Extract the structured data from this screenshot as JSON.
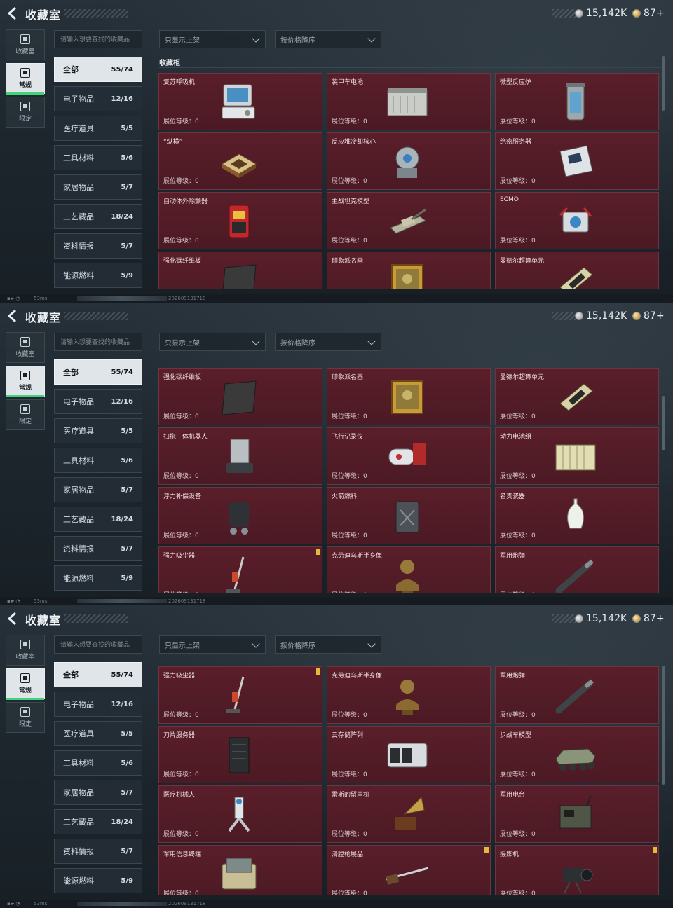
{
  "header": {
    "title": "收藏室",
    "silver_balance": "15,142K",
    "gold_balance": "87+"
  },
  "side_nav": [
    {
      "label": "收藏室",
      "icon": "collection-room-icon"
    },
    {
      "label": "常规",
      "icon": "regular-icon",
      "active": true
    },
    {
      "label": "限定",
      "icon": "limited-icon"
    }
  ],
  "search": {
    "placeholder": "请输入想要查找的收藏品"
  },
  "filter": {
    "value": "只显示上架"
  },
  "sort": {
    "value": "按价格降序"
  },
  "categories": [
    {
      "label": "全部",
      "count": "55/74",
      "active": true
    },
    {
      "label": "电子物品",
      "count": "12/16"
    },
    {
      "label": "医疗道具",
      "count": "5/5"
    },
    {
      "label": "工具材料",
      "count": "5/6"
    },
    {
      "label": "家居物品",
      "count": "5/7"
    },
    {
      "label": "工艺藏品",
      "count": "18/24"
    },
    {
      "label": "资料情报",
      "count": "5/7"
    },
    {
      "label": "能源燃料",
      "count": "5/9"
    }
  ],
  "section_title": "收藏柜",
  "level_label": "展位等级：0",
  "items": [
    {
      "name": "复苏呼吸机",
      "icon": "ventilator-icon"
    },
    {
      "name": "装甲车电池",
      "icon": "vehicle-battery-icon"
    },
    {
      "name": "微型反应炉",
      "icon": "micro-reactor-icon"
    },
    {
      "name": "“纵横”",
      "icon": "chessboard-icon"
    },
    {
      "name": "反应堆冷却核心",
      "icon": "reactor-core-icon"
    },
    {
      "name": "绝密服务器",
      "icon": "server-board-icon"
    },
    {
      "name": "自动体外除颤器",
      "icon": "defibrillator-icon"
    },
    {
      "name": "主战坦克模型",
      "icon": "tank-model-icon"
    },
    {
      "name": "ECMO",
      "icon": "ecmo-icon"
    },
    {
      "name": "强化碳纤维板",
      "icon": "carbon-plate-icon"
    },
    {
      "name": "印象派名画",
      "icon": "painting-icon"
    },
    {
      "name": "曼德尔超算单元",
      "icon": "compute-unit-icon"
    },
    {
      "name": "扫拖一体机器人",
      "icon": "robot-vacuum-icon"
    },
    {
      "name": "飞行记录仪",
      "icon": "flight-recorder-icon"
    },
    {
      "name": "动力电池组",
      "icon": "battery-pack-icon"
    },
    {
      "name": "浮力补偿设备",
      "icon": "bcd-icon"
    },
    {
      "name": "火箭燃料",
      "icon": "fuel-can-icon"
    },
    {
      "name": "名贵瓷器",
      "icon": "porcelain-vase-icon"
    },
    {
      "name": "强力吸尘器",
      "icon": "vacuum-cleaner-icon",
      "badge": true
    },
    {
      "name": "克劳迪乌斯半身像",
      "icon": "bust-icon"
    },
    {
      "name": "军用炮弹",
      "icon": "artillery-shell-icon"
    },
    {
      "name": "刀片服务器",
      "icon": "blade-server-icon"
    },
    {
      "name": "云存储阵列",
      "icon": "storage-array-icon"
    },
    {
      "name": "步战车模型",
      "icon": "ifv-model-icon"
    },
    {
      "name": "医疗机械人",
      "icon": "medical-robot-icon"
    },
    {
      "name": "雷斯的留声机",
      "icon": "gramophone-icon"
    },
    {
      "name": "军用电台",
      "icon": "military-radio-icon"
    },
    {
      "name": "军用信息终端",
      "icon": "field-terminal-icon"
    },
    {
      "name": "滑膛枪展品",
      "icon": "musket-icon",
      "badge": true
    },
    {
      "name": "摄影机",
      "icon": "camera-icon",
      "badge": true
    }
  ],
  "status": {
    "ping": "53ms",
    "timestamp": "202609131718"
  },
  "colors": {
    "card_bg": "#5a1e2a",
    "accent_green": "#43d17a",
    "badge_gold": "#e5b93a"
  }
}
